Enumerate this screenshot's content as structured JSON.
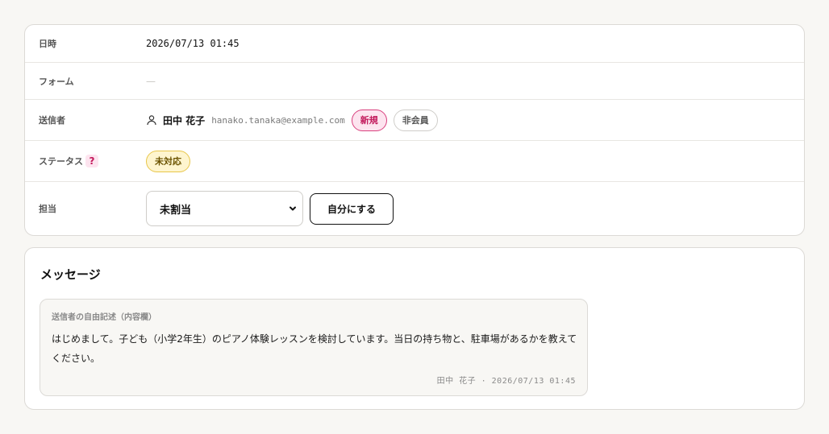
{
  "details": {
    "date_label": "日時",
    "date_value": "2026/07/13 01:45",
    "form_label": "フォーム",
    "form_value": "—",
    "sender_label": "送信者",
    "sender_name": "田中 花子",
    "sender_email": "hanako.tanaka@example.com",
    "badge_new": "新規",
    "badge_nonmember": "非会員",
    "status_label": "ステータス",
    "status_help": "?",
    "status_value": "未対応",
    "assignee_label": "担当",
    "assignee_selected": "未割当",
    "assign_self_label": "自分にする"
  },
  "message": {
    "title": "メッセージ",
    "field_label": "送信者の自由記述（内容欄）",
    "body": "はじめまして。子ども（小学2年生）のピアノ体験レッスンを検討しています。当日の持ち物と、駐車場があるかを教えてください。",
    "meta": "田中 花子 · 2026/07/13 01:45"
  },
  "colors": {
    "badge_new": "#c2185b",
    "badge_status": "#e8c64a",
    "background": "#f8f7f4"
  },
  "icons": {
    "sender": "person-icon",
    "select": "chevron-down-icon"
  }
}
